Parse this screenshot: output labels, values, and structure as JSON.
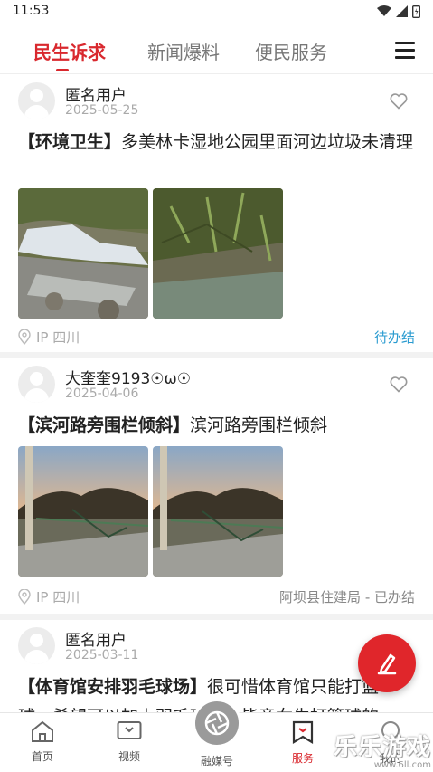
{
  "status_bar": {
    "time": "11:53"
  },
  "tabs": [
    {
      "label": "民生诉求",
      "active": true
    },
    {
      "label": "新闻爆料",
      "active": false
    },
    {
      "label": "便民服务",
      "active": false
    }
  ],
  "posts": [
    {
      "user": "匿名用户",
      "date": "2025-05-25",
      "tag": "【环境卫生】",
      "text": "多美林卡湿地公园里面河边垃圾未清理",
      "ip": "IP 四川",
      "status": "待办结"
    },
    {
      "user": "大奎奎9193☉ω☉",
      "date": "2025-04-06",
      "tag": "【滨河路旁围栏倾斜】",
      "text": "滨河路旁围栏倾斜",
      "ip": "IP 四川",
      "status": "阿坝县住建局 - 已办结"
    },
    {
      "user": "匿名用户",
      "date": "2025-03-11",
      "tag": "【体育馆安排羽毛球场】",
      "text": "很可惜体育馆只能打篮球，希望可以加上羽毛球场，毕竟女生打篮球的还"
    }
  ],
  "bottom_nav": {
    "home": "首页",
    "video": "视频",
    "center": "融媒号",
    "service": "服务",
    "mine": "我的"
  },
  "watermark": {
    "text": "乐乐游戏",
    "url": "www.6ll.com"
  },
  "colors": {
    "accent": "#d9282e",
    "pending": "#2a9bd0"
  },
  "icons": [
    "wifi-icon",
    "signal-icon",
    "battery-icon",
    "menu-icon",
    "heart-icon",
    "location-icon",
    "edit-icon",
    "home-icon",
    "video-icon",
    "camera-icon",
    "bookmark-icon",
    "search-icon"
  ]
}
